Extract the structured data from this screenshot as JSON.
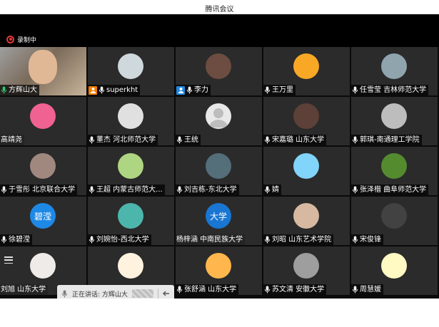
{
  "window": {
    "title": "腾讯会议"
  },
  "recording": {
    "label": "录制中",
    "color": "#e53935"
  },
  "participants": [
    {
      "name": "方辉山大",
      "avatar": "video",
      "avatar_color": "#8c7a68",
      "avatar_text": "",
      "role": "",
      "mic": true
    },
    {
      "name": "superkht",
      "avatar": "photo",
      "avatar_color": "#cfd8dc",
      "avatar_text": "",
      "role": "host-orange",
      "mic": true
    },
    {
      "name": "李力",
      "avatar": "photo",
      "avatar_color": "#6d4c41",
      "avatar_text": "",
      "role": "cohost-blue",
      "mic": true
    },
    {
      "name": "王万里",
      "avatar": "photo",
      "avatar_color": "#f9a825",
      "avatar_text": "",
      "role": "",
      "mic": true
    },
    {
      "name": "任雪莹 吉林师范大学",
      "avatar": "photo",
      "avatar_color": "#90a4ae",
      "avatar_text": "",
      "role": "",
      "mic": true
    },
    {
      "name": "高靖尧",
      "avatar": "photo",
      "avatar_color": "#f06292",
      "avatar_text": "",
      "role": "",
      "mic": false
    },
    {
      "name": "董杰 河北师范大学",
      "avatar": "photo",
      "avatar_color": "#e0e0e0",
      "avatar_text": "",
      "role": "",
      "mic": true
    },
    {
      "name": "王统",
      "avatar": "default",
      "avatar_color": "#e8e8e8",
      "avatar_text": "",
      "role": "",
      "mic": true
    },
    {
      "name": "宋嘉璐 山东大学",
      "avatar": "photo",
      "avatar_color": "#5d4037",
      "avatar_text": "",
      "role": "",
      "mic": true
    },
    {
      "name": "郭琪-南通理工学院",
      "avatar": "photo",
      "avatar_color": "#bdbdbd",
      "avatar_text": "",
      "role": "",
      "mic": true
    },
    {
      "name": "于雪彤 北京联合大学",
      "avatar": "photo",
      "avatar_color": "#a1887f",
      "avatar_text": "",
      "role": "",
      "mic": true
    },
    {
      "name": "王超 内蒙古师范大...",
      "avatar": "photo",
      "avatar_color": "#aed581",
      "avatar_text": "",
      "role": "",
      "mic": true
    },
    {
      "name": "刘吉栋-东北大学",
      "avatar": "photo",
      "avatar_color": "#546e7a",
      "avatar_text": "",
      "role": "",
      "mic": true
    },
    {
      "name": "婧",
      "avatar": "photo",
      "avatar_color": "#81d4fa",
      "avatar_text": "",
      "role": "",
      "mic": true
    },
    {
      "name": "张泽楷 曲阜师范大学",
      "avatar": "photo",
      "avatar_color": "#558b2f",
      "avatar_text": "",
      "role": "",
      "mic": true
    },
    {
      "name": "徐碧滢",
      "avatar": "text",
      "avatar_color": "#1e88e5",
      "avatar_text": "碧滢",
      "role": "",
      "mic": true
    },
    {
      "name": "刘婉怡-西北大学",
      "avatar": "photo",
      "avatar_color": "#4db6ac",
      "avatar_text": "",
      "role": "",
      "mic": true
    },
    {
      "name": "杨梓涵 中南民族大学",
      "avatar": "text",
      "avatar_color": "#1976d2",
      "avatar_text": "大学",
      "role": "",
      "mic": false
    },
    {
      "name": "刘昭 山东艺术学院",
      "avatar": "photo",
      "avatar_color": "#d7b8a0",
      "avatar_text": "",
      "role": "",
      "mic": true
    },
    {
      "name": "宋俊锋",
      "avatar": "photo",
      "avatar_color": "#424242",
      "avatar_text": "",
      "role": "",
      "mic": true
    },
    {
      "name": "刘旭 山东大学",
      "avatar": "photo",
      "avatar_color": "#efebe9",
      "avatar_text": "",
      "role": "",
      "mic": false
    },
    {
      "name": "",
      "avatar": "photo",
      "avatar_color": "#fff3e0",
      "avatar_text": "",
      "role": "",
      "mic": false
    },
    {
      "name": "张舒涵 山东大学",
      "avatar": "photo",
      "avatar_color": "#ffb74d",
      "avatar_text": "",
      "role": "",
      "mic": true
    },
    {
      "name": "苏文清 安徽大学",
      "avatar": "photo",
      "avatar_color": "#9e9e9e",
      "avatar_text": "",
      "role": "",
      "mic": true
    },
    {
      "name": "周慧媛",
      "avatar": "photo",
      "avatar_color": "#fff9c4",
      "avatar_text": "",
      "role": "",
      "mic": true
    }
  ],
  "speaking": {
    "label": "正在讲话: 方辉山大"
  },
  "colors": {
    "tile_bg": "#2b2b2b",
    "gap_bg": "#0a0a0a",
    "mic_green": "#2ecc71"
  }
}
